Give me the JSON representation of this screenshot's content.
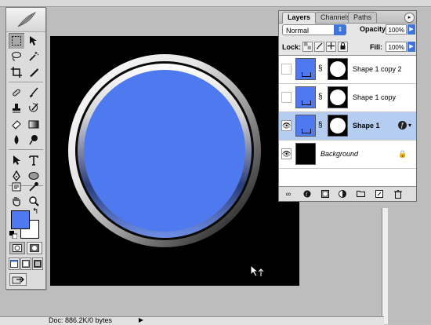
{
  "status_bar": {
    "doc_size": "Doc: 886.2K/0 bytes",
    "menu_arrow": "▶"
  },
  "canvas": {
    "background_color": "#000000",
    "circle_fill": "#4f79ef"
  },
  "tools": {
    "swap_glyph": "↰",
    "foreground_color": "#4f79ef",
    "background_color": "#ffffff"
  },
  "layers_palette": {
    "tabs": [
      {
        "label": "Layers",
        "active": true
      },
      {
        "label": "Channels",
        "active": false
      },
      {
        "label": "Paths",
        "active": false
      }
    ],
    "menu_glyph": "▸",
    "blend_mode": "Normal",
    "opacity_label": "Opacity:",
    "opacity_value": "100%",
    "lock_label": "Lock:",
    "fill_label": "Fill:",
    "fill_value": "100%",
    "layers": [
      {
        "name": "Shape 1 copy 2",
        "visible": false,
        "selected": false,
        "type": "shape"
      },
      {
        "name": "Shape 1 copy",
        "visible": false,
        "selected": false,
        "type": "shape"
      },
      {
        "name": "Shape 1",
        "visible": true,
        "selected": true,
        "type": "shape",
        "has_effects": true
      },
      {
        "name": "Background",
        "visible": true,
        "selected": false,
        "type": "background",
        "locked": true
      }
    ]
  }
}
